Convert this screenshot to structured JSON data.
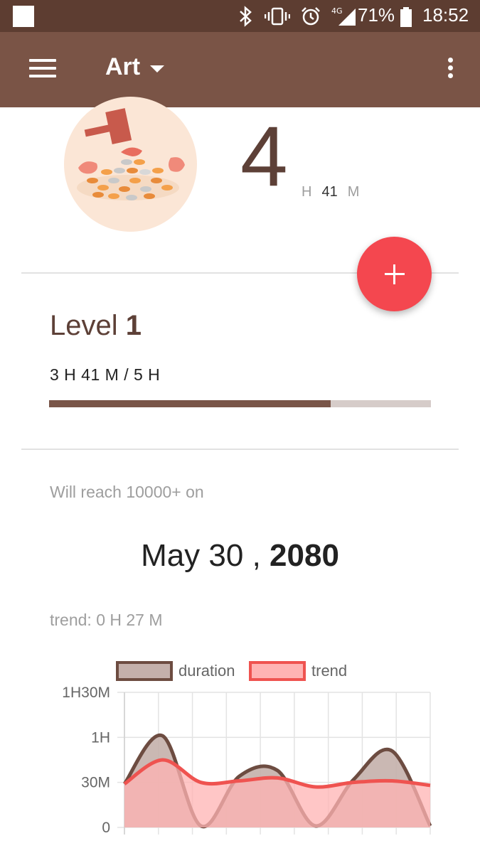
{
  "status_bar": {
    "battery": "71%",
    "time": "18:52",
    "network": "4G"
  },
  "app_bar": {
    "title": "Art",
    "icons": [
      "menu-icon",
      "dropdown-caret-icon",
      "more-vert-icon"
    ]
  },
  "summary": {
    "hours_big": "4",
    "hours_unit": "H",
    "minutes": "41",
    "minutes_unit": "M"
  },
  "fab": {
    "icon": "plus-icon"
  },
  "level": {
    "label": "Level",
    "number": "1",
    "progress_text": "3 H 41 M / 5 H",
    "progress_fraction": 0.737
  },
  "projection": {
    "label": "Will reach 10000+ on",
    "date_part": "May 30 , ",
    "year": "2080",
    "trend_text": "trend: 0 H 27 M"
  },
  "colors": {
    "status_bar": "#5d3d31",
    "app_bar": "#7a5446",
    "accent_fab": "#f4474f",
    "progress_fill": "#795548",
    "progress_track": "#d6ccc9",
    "duration_line": "#6d4c41",
    "duration_fill": "#c4b0ab",
    "trend_line": "#ef5350",
    "trend_fill": "#ffb3b3"
  },
  "chart_data": {
    "type": "area",
    "legend": [
      "duration",
      "trend"
    ],
    "legend_position": "top",
    "y_tick_labels": [
      "1H30M",
      "1H",
      "30M",
      "0"
    ],
    "ylim_minutes": [
      0,
      90
    ],
    "grid": true,
    "points": 10,
    "series": [
      {
        "name": "duration",
        "values": [
          29,
          61,
          1,
          34,
          38,
          1,
          32,
          51,
          1
        ]
      },
      {
        "name": "trend",
        "values": [
          29,
          45,
          30,
          31,
          33,
          27,
          30,
          31,
          28
        ]
      }
    ]
  }
}
